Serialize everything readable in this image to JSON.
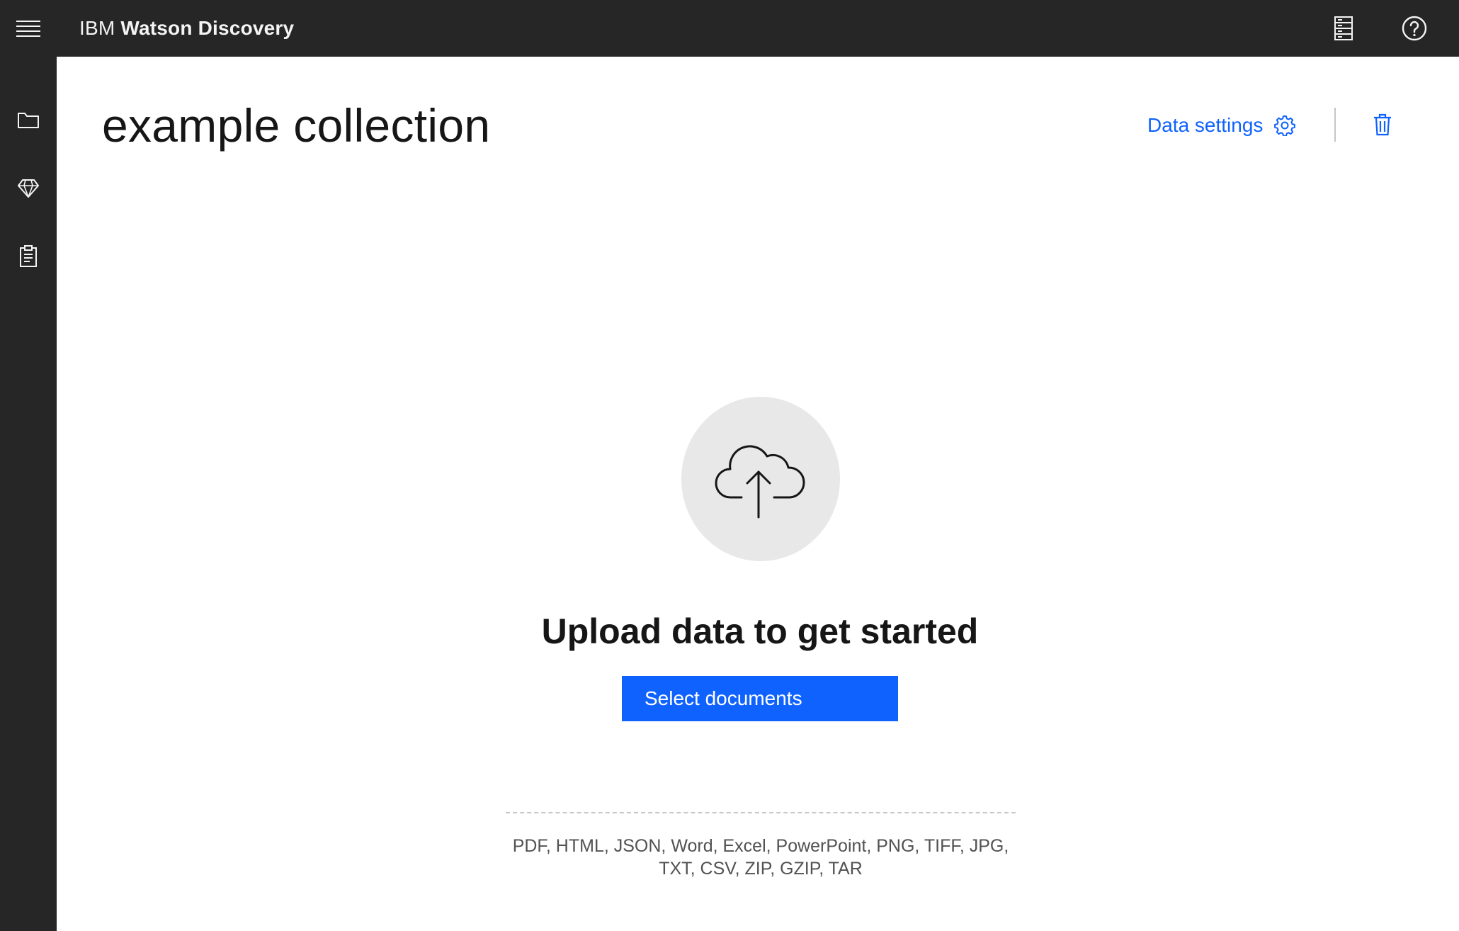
{
  "header": {
    "brand_prefix": "IBM",
    "brand_name": "Watson Discovery",
    "icons": [
      "menu-icon",
      "server-icon",
      "help-icon"
    ]
  },
  "sidenav": {
    "items": [
      {
        "icon": "folder-icon"
      },
      {
        "icon": "diamond-icon"
      },
      {
        "icon": "clipboard-icon"
      }
    ]
  },
  "main": {
    "title": "example collection",
    "data_settings_label": "Data settings",
    "upload_heading": "Upload data to get started",
    "select_button_label": "Select documents",
    "supported_formats": "PDF, HTML, JSON, Word, Excel, PowerPoint, PNG, TIFF, JPG, TXT, CSV, ZIP, GZIP, TAR"
  },
  "colors": {
    "header_bg": "#262626",
    "accent": "#0f62fe",
    "upload_circle_bg": "#e8e8e8",
    "text_primary": "#161616",
    "text_secondary": "#525252"
  }
}
